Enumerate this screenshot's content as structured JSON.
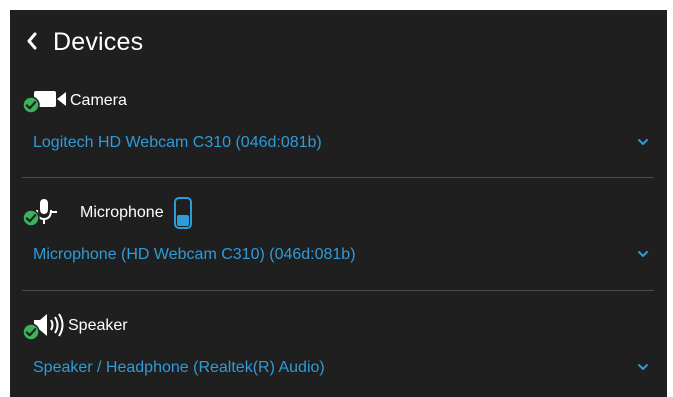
{
  "header": {
    "title": "Devices",
    "back_icon": "chevron-left-icon"
  },
  "colors": {
    "background": "#1f1f1f",
    "accent": "#2f9bd8",
    "status_ok": "#3bb35a",
    "divider": "#4a4a4a",
    "text": "#ffffff"
  },
  "devices": [
    {
      "label": "Camera",
      "icon": "video-camera-icon",
      "status_icon": "check-circle-icon",
      "selected": "Logitech HD Webcam C310 (046d:081b)"
    },
    {
      "label": "Microphone",
      "icon": "microphone-icon",
      "status_icon": "check-circle-icon",
      "level_icon": "mic-level-meter-icon",
      "selected": "Microphone (HD Webcam C310) (046d:081b)"
    },
    {
      "label": "Speaker",
      "icon": "speaker-icon",
      "status_icon": "check-circle-icon",
      "selected": "Speaker / Headphone (Realtek(R) Audio)"
    }
  ]
}
